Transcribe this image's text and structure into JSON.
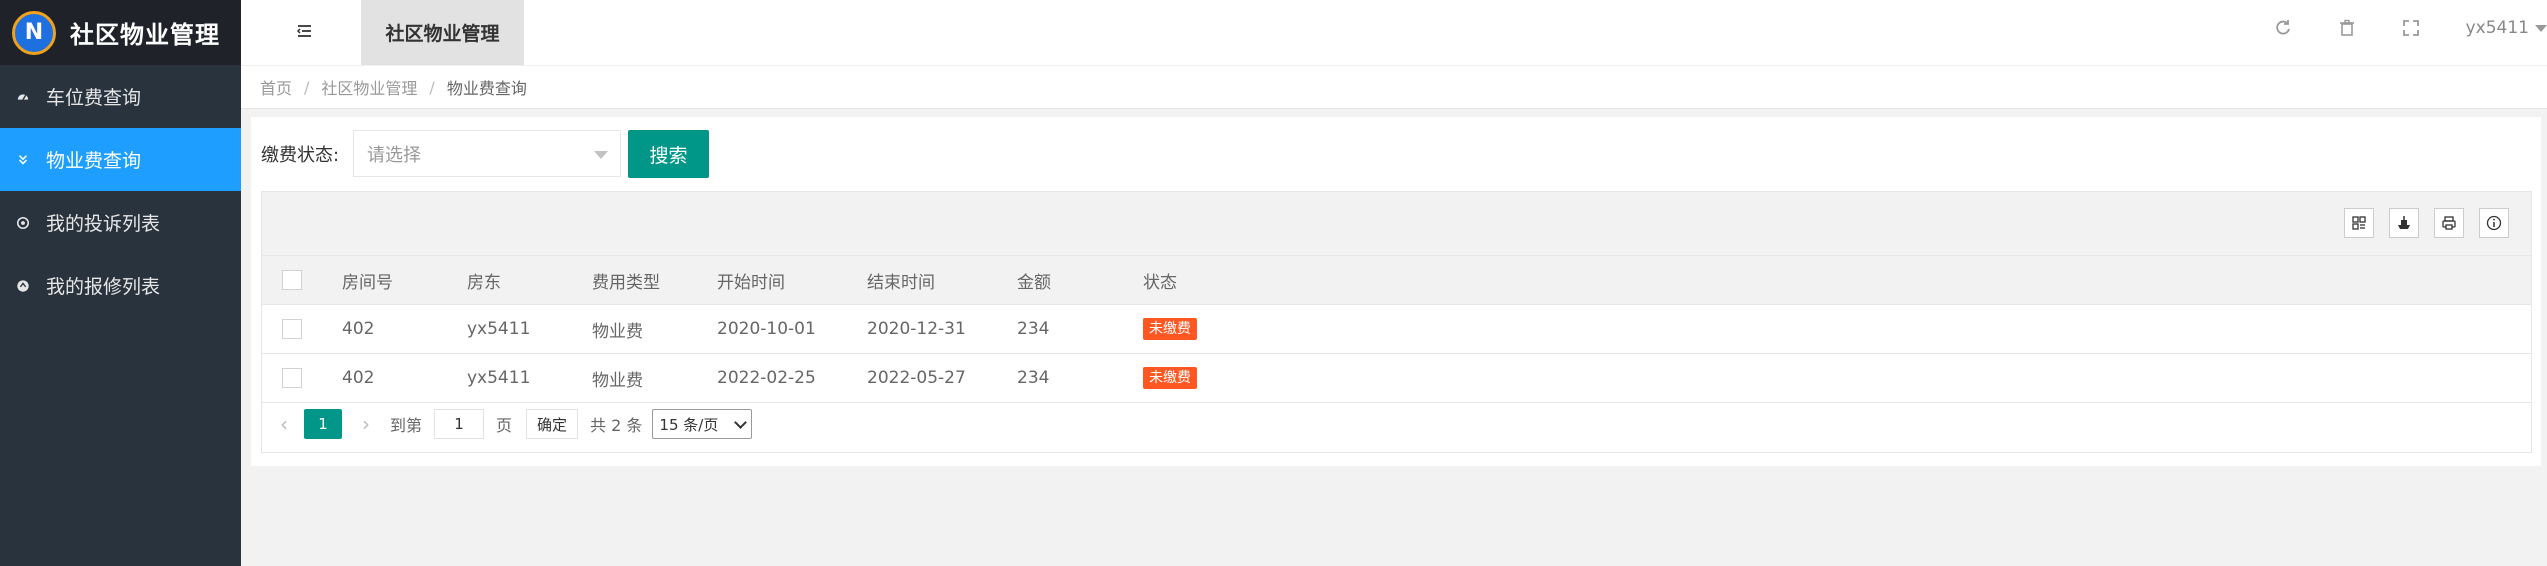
{
  "sidebar": {
    "logo_letter": "N",
    "app_title": "社区物业管理",
    "items": [
      {
        "label": "车位费查询",
        "icon": "dashboard-icon",
        "active": false
      },
      {
        "label": "物业费查询",
        "icon": "double-chevron-down-icon",
        "active": true
      },
      {
        "label": "我的投诉列表",
        "icon": "circle-dot-icon",
        "active": false
      },
      {
        "label": "我的报修列表",
        "icon": "radio-icon",
        "active": false
      }
    ]
  },
  "header": {
    "tab_label": "社区物业管理",
    "username": "yx5411"
  },
  "breadcrumb": [
    "首页",
    "社区物业管理",
    "物业费查询"
  ],
  "filter": {
    "label": "缴费状态:",
    "placeholder": "请选择",
    "search_label": "搜索"
  },
  "table": {
    "columns": [
      "房间号",
      "房东",
      "费用类型",
      "开始时间",
      "结束时间",
      "金额",
      "状态"
    ],
    "rows": [
      {
        "room": "402",
        "owner": "yx5411",
        "type": "物业费",
        "start": "2020-10-01",
        "end": "2020-12-31",
        "amount": "234",
        "status": "未缴费"
      },
      {
        "room": "402",
        "owner": "yx5411",
        "type": "物业费",
        "start": "2022-02-25",
        "end": "2022-05-27",
        "amount": "234",
        "status": "未缴费"
      }
    ]
  },
  "pager": {
    "prev": "‹",
    "current": "1",
    "next": "›",
    "goto_label": "到第",
    "goto_value": "1",
    "page_unit": "页",
    "confirm_label": "确定",
    "total_label": "共 2 条",
    "page_size": "15 条/页"
  },
  "colors": {
    "sidebar_bg": "#28333e",
    "active_blue": "#1e9fff",
    "teal": "#009688",
    "badge_orange": "#ff5722"
  }
}
